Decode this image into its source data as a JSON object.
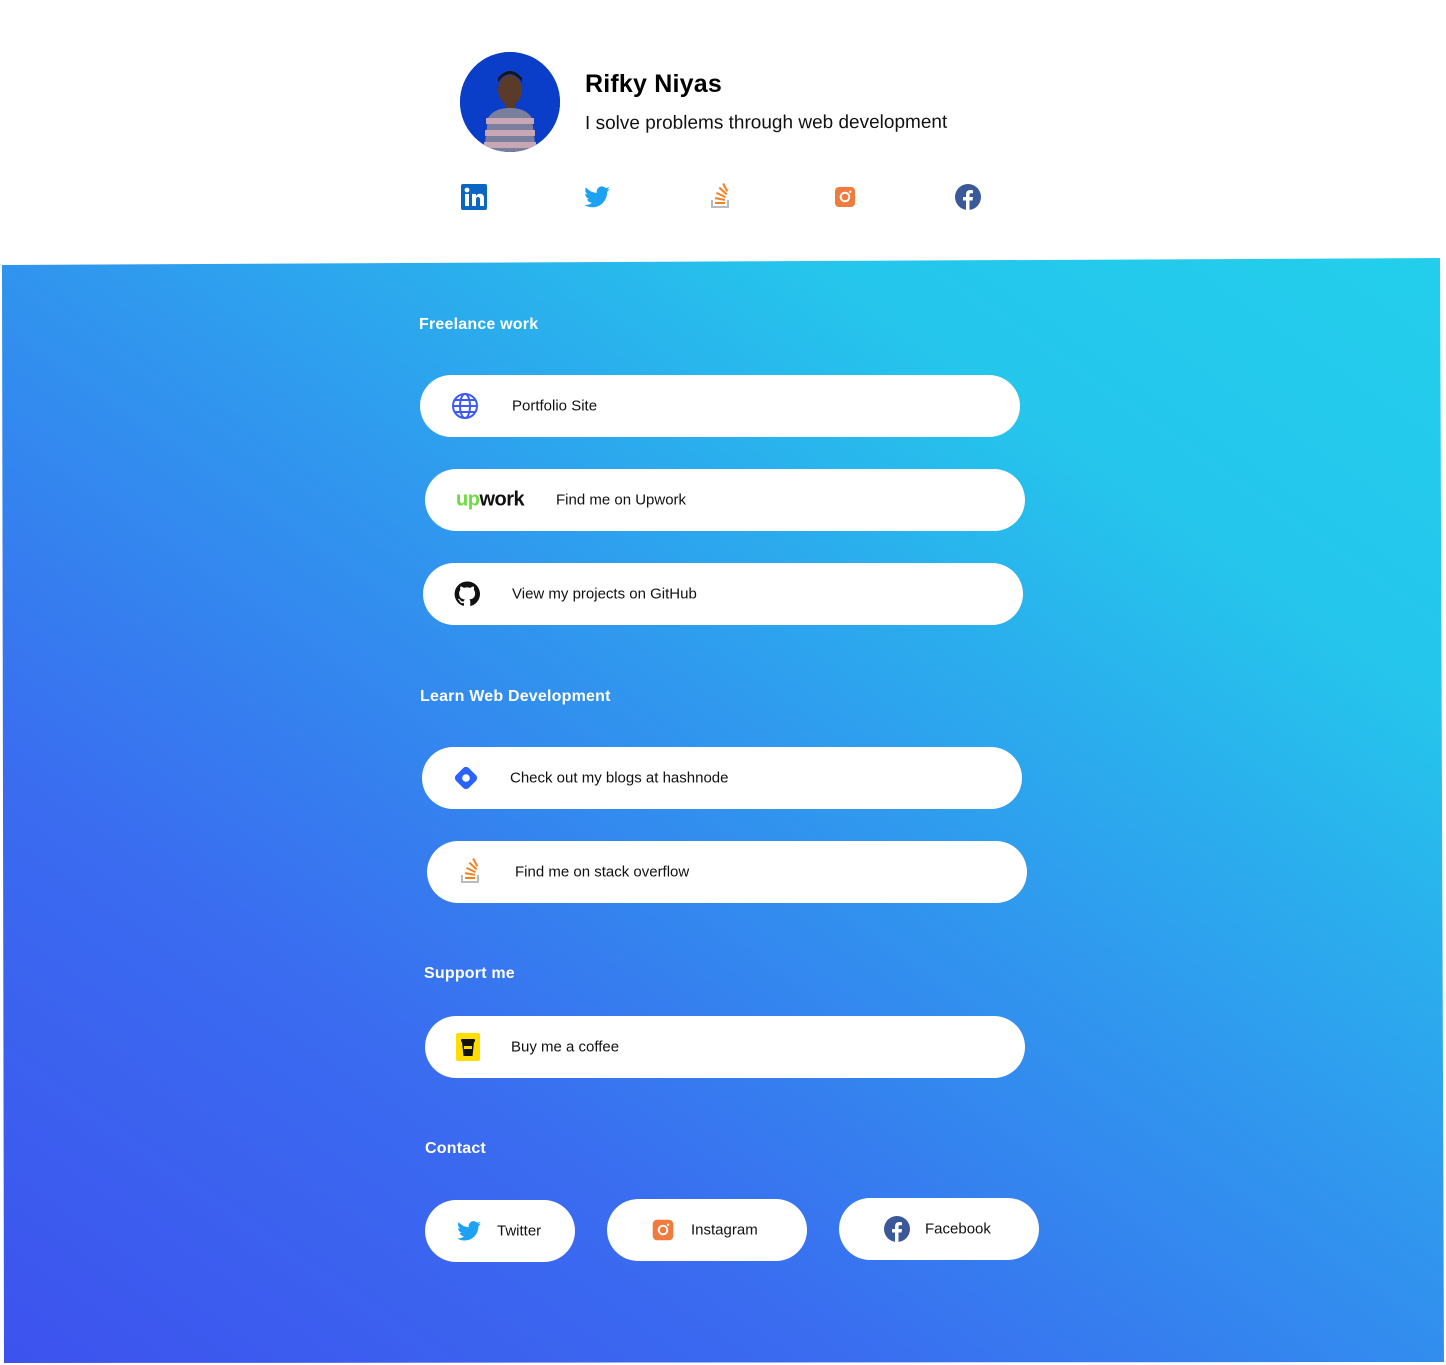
{
  "profile": {
    "name": "Rifky Niyas",
    "tagline": "I solve problems through web development"
  },
  "social_icons": [
    {
      "name": "linkedin-icon",
      "color": "#0a66c2"
    },
    {
      "name": "twitter-icon",
      "color": "#1da1f2"
    },
    {
      "name": "stackoverflow-icon",
      "color": "#f48024"
    },
    {
      "name": "instagram-icon",
      "color": "#f07b3f"
    },
    {
      "name": "facebook-icon",
      "color": "#3b5998"
    }
  ],
  "sections": {
    "freelance": {
      "title": "Freelance work",
      "links": [
        {
          "label": "Portfolio Site",
          "icon": "globe-icon"
        },
        {
          "label": "Find me on Upwork",
          "icon": "upwork-logo",
          "logo_up": "up",
          "logo_work": "work"
        },
        {
          "label": "View my projects on GitHub",
          "icon": "github-icon"
        }
      ]
    },
    "learn": {
      "title": "Learn Web Development",
      "links": [
        {
          "label": "Check out my blogs at hashnode",
          "icon": "hashnode-icon"
        },
        {
          "label": "Find me on stack overflow",
          "icon": "stackoverflow-icon"
        }
      ]
    },
    "support": {
      "title": "Support me",
      "links": [
        {
          "label": "Buy me a coffee",
          "icon": "coffee-icon"
        }
      ]
    },
    "contact": {
      "title": "Contact",
      "links": [
        {
          "label": "Twitter",
          "icon": "twitter-icon"
        },
        {
          "label": "Instagram",
          "icon": "instagram-icon"
        },
        {
          "label": "Facebook",
          "icon": "facebook-icon"
        }
      ]
    }
  },
  "colors": {
    "gradient_start": "#3d52ee",
    "gradient_end": "#22d4ec",
    "accent_blue": "#3d5afe",
    "upwork_green": "#6fda44",
    "coffee_yellow": "#ffdd00"
  }
}
